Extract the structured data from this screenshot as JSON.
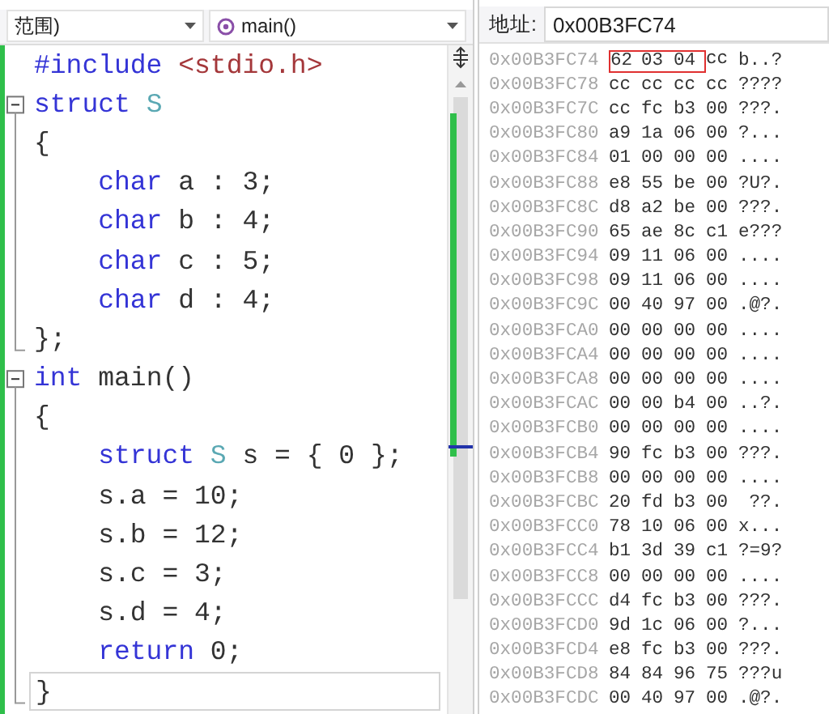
{
  "editor": {
    "scope_dropdown": {
      "value": "范围)"
    },
    "function_dropdown": {
      "value": "main()"
    },
    "lines": [
      {
        "collapsible": false,
        "fold_end": false,
        "current": false,
        "tokens": [
          {
            "kind": "keyword",
            "text": "#include "
          },
          {
            "kind": "string",
            "text": "<stdio.h>"
          }
        ]
      },
      {
        "collapsible": true,
        "fold_end": false,
        "current": false,
        "tokens": [
          {
            "kind": "keyword",
            "text": "struct "
          },
          {
            "kind": "type",
            "text": "S"
          }
        ]
      },
      {
        "collapsible": false,
        "fold_end": false,
        "current": false,
        "tokens": [
          {
            "kind": "plain",
            "text": "{"
          }
        ]
      },
      {
        "collapsible": false,
        "fold_end": false,
        "current": false,
        "tokens": [
          {
            "kind": "keyword",
            "text": "    char"
          },
          {
            "kind": "plain",
            "text": " a : 3;"
          }
        ]
      },
      {
        "collapsible": false,
        "fold_end": false,
        "current": false,
        "tokens": [
          {
            "kind": "keyword",
            "text": "    char"
          },
          {
            "kind": "plain",
            "text": " b : 4;"
          }
        ]
      },
      {
        "collapsible": false,
        "fold_end": false,
        "current": false,
        "tokens": [
          {
            "kind": "keyword",
            "text": "    char"
          },
          {
            "kind": "plain",
            "text": " c : 5;"
          }
        ]
      },
      {
        "collapsible": false,
        "fold_end": false,
        "current": false,
        "tokens": [
          {
            "kind": "keyword",
            "text": "    char"
          },
          {
            "kind": "plain",
            "text": " d : 4;"
          }
        ]
      },
      {
        "collapsible": false,
        "fold_end": true,
        "current": false,
        "tokens": [
          {
            "kind": "plain",
            "text": "};"
          }
        ]
      },
      {
        "collapsible": true,
        "fold_end": false,
        "current": false,
        "tokens": [
          {
            "kind": "keyword",
            "text": "int"
          },
          {
            "kind": "plain",
            "text": " main()"
          }
        ]
      },
      {
        "collapsible": false,
        "fold_end": false,
        "current": false,
        "tokens": [
          {
            "kind": "plain",
            "text": "{"
          }
        ]
      },
      {
        "collapsible": false,
        "fold_end": false,
        "current": false,
        "tokens": [
          {
            "kind": "keyword",
            "text": "    struct "
          },
          {
            "kind": "type",
            "text": "S"
          },
          {
            "kind": "plain",
            "text": " s = { 0 };"
          }
        ]
      },
      {
        "collapsible": false,
        "fold_end": false,
        "current": false,
        "tokens": [
          {
            "kind": "plain",
            "text": "    s.a = 10;"
          }
        ]
      },
      {
        "collapsible": false,
        "fold_end": false,
        "current": false,
        "tokens": [
          {
            "kind": "plain",
            "text": "    s.b = 12;"
          }
        ]
      },
      {
        "collapsible": false,
        "fold_end": false,
        "current": false,
        "tokens": [
          {
            "kind": "plain",
            "text": "    s.c = 3;"
          }
        ]
      },
      {
        "collapsible": false,
        "fold_end": false,
        "current": false,
        "tokens": [
          {
            "kind": "plain",
            "text": "    s.d = 4;"
          }
        ]
      },
      {
        "collapsible": false,
        "fold_end": false,
        "current": false,
        "tokens": [
          {
            "kind": "keyword",
            "text": "    return"
          },
          {
            "kind": "plain",
            "text": " 0;"
          }
        ]
      },
      {
        "collapsible": false,
        "fold_end": true,
        "current": true,
        "tokens": [
          {
            "kind": "plain",
            "text": "}"
          }
        ]
      }
    ]
  },
  "memory": {
    "address_label": "地址:",
    "address_value": "0x00B3FC74",
    "rows": [
      {
        "address": "0x00B3FC74",
        "bytes": [
          {
            "v": "62",
            "boxed": true
          },
          {
            "v": "03",
            "boxed": true
          },
          {
            "v": "04",
            "boxed": true
          },
          {
            "v": "cc",
            "boxed": false
          }
        ],
        "text": "b..?"
      },
      {
        "address": "0x00B3FC78",
        "bytes": [
          {
            "v": "cc",
            "boxed": false
          },
          {
            "v": "cc",
            "boxed": false
          },
          {
            "v": "cc",
            "boxed": false
          },
          {
            "v": "cc",
            "boxed": false
          }
        ],
        "text": "????"
      },
      {
        "address": "0x00B3FC7C",
        "bytes": [
          {
            "v": "cc",
            "boxed": false
          },
          {
            "v": "fc",
            "boxed": false
          },
          {
            "v": "b3",
            "boxed": false
          },
          {
            "v": "00",
            "boxed": false
          }
        ],
        "text": "???."
      },
      {
        "address": "0x00B3FC80",
        "bytes": [
          {
            "v": "a9",
            "boxed": false
          },
          {
            "v": "1a",
            "boxed": false
          },
          {
            "v": "06",
            "boxed": false
          },
          {
            "v": "00",
            "boxed": false
          }
        ],
        "text": "?..."
      },
      {
        "address": "0x00B3FC84",
        "bytes": [
          {
            "v": "01",
            "boxed": false
          },
          {
            "v": "00",
            "boxed": false
          },
          {
            "v": "00",
            "boxed": false
          },
          {
            "v": "00",
            "boxed": false
          }
        ],
        "text": "...."
      },
      {
        "address": "0x00B3FC88",
        "bytes": [
          {
            "v": "e8",
            "boxed": false
          },
          {
            "v": "55",
            "boxed": false
          },
          {
            "v": "be",
            "boxed": false
          },
          {
            "v": "00",
            "boxed": false
          }
        ],
        "text": "?U?."
      },
      {
        "address": "0x00B3FC8C",
        "bytes": [
          {
            "v": "d8",
            "boxed": false
          },
          {
            "v": "a2",
            "boxed": false
          },
          {
            "v": "be",
            "boxed": false
          },
          {
            "v": "00",
            "boxed": false
          }
        ],
        "text": "???."
      },
      {
        "address": "0x00B3FC90",
        "bytes": [
          {
            "v": "65",
            "boxed": false
          },
          {
            "v": "ae",
            "boxed": false
          },
          {
            "v": "8c",
            "boxed": false
          },
          {
            "v": "c1",
            "boxed": false
          }
        ],
        "text": "e???"
      },
      {
        "address": "0x00B3FC94",
        "bytes": [
          {
            "v": "09",
            "boxed": false
          },
          {
            "v": "11",
            "boxed": false
          },
          {
            "v": "06",
            "boxed": false
          },
          {
            "v": "00",
            "boxed": false
          }
        ],
        "text": "...."
      },
      {
        "address": "0x00B3FC98",
        "bytes": [
          {
            "v": "09",
            "boxed": false
          },
          {
            "v": "11",
            "boxed": false
          },
          {
            "v": "06",
            "boxed": false
          },
          {
            "v": "00",
            "boxed": false
          }
        ],
        "text": "...."
      },
      {
        "address": "0x00B3FC9C",
        "bytes": [
          {
            "v": "00",
            "boxed": false
          },
          {
            "v": "40",
            "boxed": false
          },
          {
            "v": "97",
            "boxed": false
          },
          {
            "v": "00",
            "boxed": false
          }
        ],
        "text": ".@?."
      },
      {
        "address": "0x00B3FCA0",
        "bytes": [
          {
            "v": "00",
            "boxed": false
          },
          {
            "v": "00",
            "boxed": false
          },
          {
            "v": "00",
            "boxed": false
          },
          {
            "v": "00",
            "boxed": false
          }
        ],
        "text": "...."
      },
      {
        "address": "0x00B3FCA4",
        "bytes": [
          {
            "v": "00",
            "boxed": false
          },
          {
            "v": "00",
            "boxed": false
          },
          {
            "v": "00",
            "boxed": false
          },
          {
            "v": "00",
            "boxed": false
          }
        ],
        "text": "...."
      },
      {
        "address": "0x00B3FCA8",
        "bytes": [
          {
            "v": "00",
            "boxed": false
          },
          {
            "v": "00",
            "boxed": false
          },
          {
            "v": "00",
            "boxed": false
          },
          {
            "v": "00",
            "boxed": false
          }
        ],
        "text": "...."
      },
      {
        "address": "0x00B3FCAC",
        "bytes": [
          {
            "v": "00",
            "boxed": false
          },
          {
            "v": "00",
            "boxed": false
          },
          {
            "v": "b4",
            "boxed": false
          },
          {
            "v": "00",
            "boxed": false
          }
        ],
        "text": "..?."
      },
      {
        "address": "0x00B3FCB0",
        "bytes": [
          {
            "v": "00",
            "boxed": false
          },
          {
            "v": "00",
            "boxed": false
          },
          {
            "v": "00",
            "boxed": false
          },
          {
            "v": "00",
            "boxed": false
          }
        ],
        "text": "...."
      },
      {
        "address": "0x00B3FCB4",
        "bytes": [
          {
            "v": "90",
            "boxed": false
          },
          {
            "v": "fc",
            "boxed": false
          },
          {
            "v": "b3",
            "boxed": false
          },
          {
            "v": "00",
            "boxed": false
          }
        ],
        "text": "???."
      },
      {
        "address": "0x00B3FCB8",
        "bytes": [
          {
            "v": "00",
            "boxed": false
          },
          {
            "v": "00",
            "boxed": false
          },
          {
            "v": "00",
            "boxed": false
          },
          {
            "v": "00",
            "boxed": false
          }
        ],
        "text": "...."
      },
      {
        "address": "0x00B3FCBC",
        "bytes": [
          {
            "v": "20",
            "boxed": false
          },
          {
            "v": "fd",
            "boxed": false
          },
          {
            "v": "b3",
            "boxed": false
          },
          {
            "v": "00",
            "boxed": false
          }
        ],
        "text": " ??."
      },
      {
        "address": "0x00B3FCC0",
        "bytes": [
          {
            "v": "78",
            "boxed": false
          },
          {
            "v": "10",
            "boxed": false
          },
          {
            "v": "06",
            "boxed": false
          },
          {
            "v": "00",
            "boxed": false
          }
        ],
        "text": "x..."
      },
      {
        "address": "0x00B3FCC4",
        "bytes": [
          {
            "v": "b1",
            "boxed": false
          },
          {
            "v": "3d",
            "boxed": false
          },
          {
            "v": "39",
            "boxed": false
          },
          {
            "v": "c1",
            "boxed": false
          }
        ],
        "text": "?=9?"
      },
      {
        "address": "0x00B3FCC8",
        "bytes": [
          {
            "v": "00",
            "boxed": false
          },
          {
            "v": "00",
            "boxed": false
          },
          {
            "v": "00",
            "boxed": false
          },
          {
            "v": "00",
            "boxed": false
          }
        ],
        "text": "...."
      },
      {
        "address": "0x00B3FCCC",
        "bytes": [
          {
            "v": "d4",
            "boxed": false
          },
          {
            "v": "fc",
            "boxed": false
          },
          {
            "v": "b3",
            "boxed": false
          },
          {
            "v": "00",
            "boxed": false
          }
        ],
        "text": "???."
      },
      {
        "address": "0x00B3FCD0",
        "bytes": [
          {
            "v": "9d",
            "boxed": false
          },
          {
            "v": "1c",
            "boxed": false
          },
          {
            "v": "06",
            "boxed": false
          },
          {
            "v": "00",
            "boxed": false
          }
        ],
        "text": "?..."
      },
      {
        "address": "0x00B3FCD4",
        "bytes": [
          {
            "v": "e8",
            "boxed": false
          },
          {
            "v": "fc",
            "boxed": false
          },
          {
            "v": "b3",
            "boxed": false
          },
          {
            "v": "00",
            "boxed": false
          }
        ],
        "text": "???."
      },
      {
        "address": "0x00B3FCD8",
        "bytes": [
          {
            "v": "84",
            "boxed": false
          },
          {
            "v": "84",
            "boxed": false
          },
          {
            "v": "96",
            "boxed": false
          },
          {
            "v": "75",
            "boxed": false
          }
        ],
        "text": "???u"
      },
      {
        "address": "0x00B3FCDC",
        "bytes": [
          {
            "v": "00",
            "boxed": false
          },
          {
            "v": "40",
            "boxed": false
          },
          {
            "v": "97",
            "boxed": false
          },
          {
            "v": "00",
            "boxed": false
          }
        ],
        "text": ".@?."
      }
    ]
  }
}
